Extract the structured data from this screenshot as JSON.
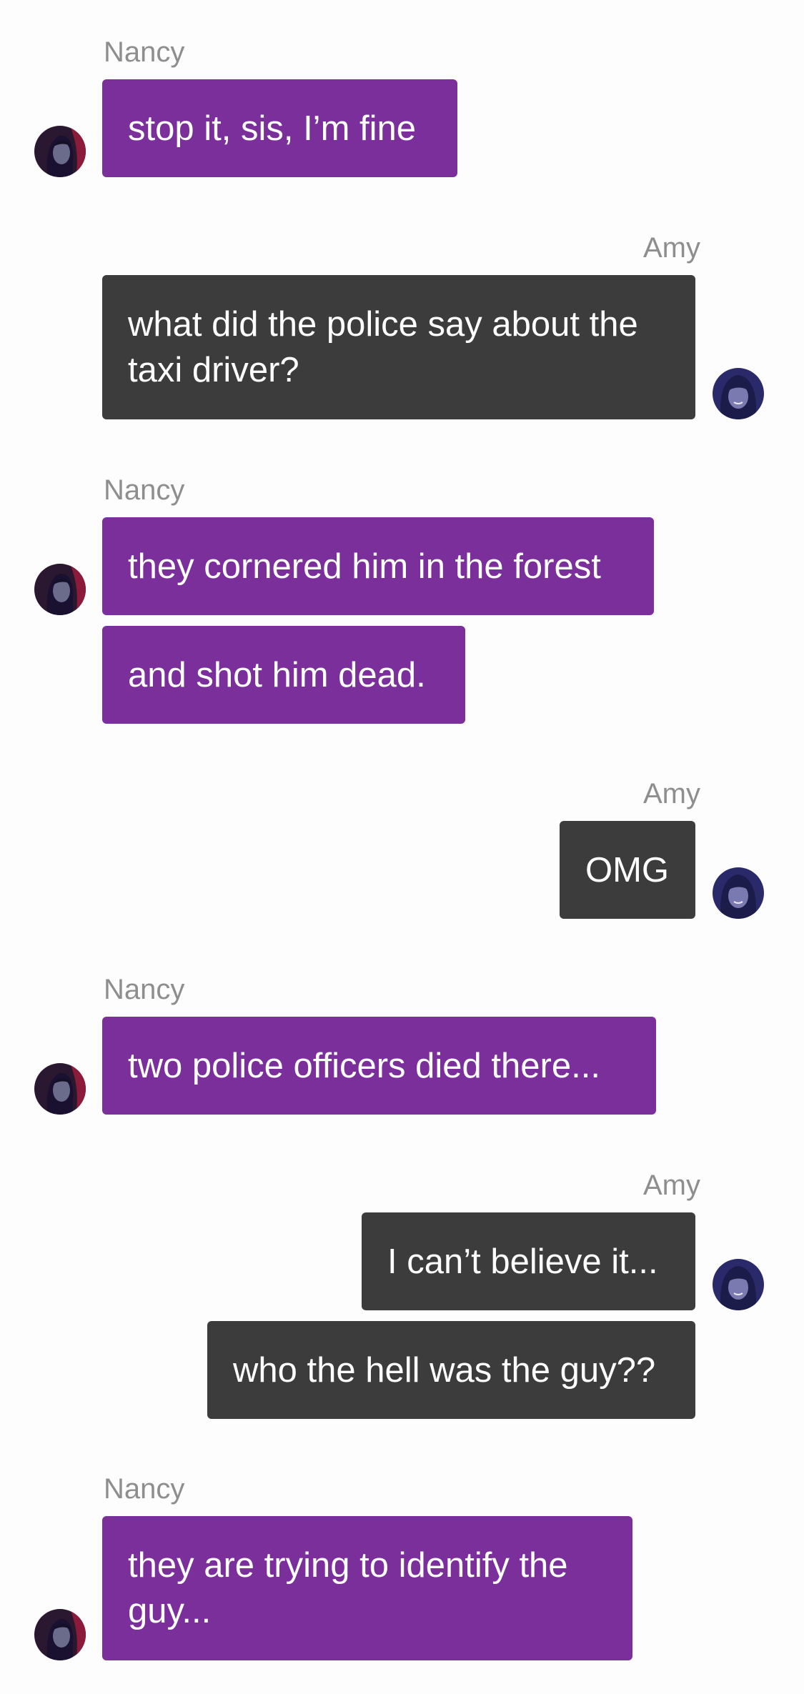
{
  "colors": {
    "background": "#fdfdfd",
    "nancy_bubble": "#7b2f9b",
    "amy_bubble": "#3c3c3c",
    "name_text": "#8e8e8e",
    "bubble_text": "#ffffff"
  },
  "participants": {
    "nancy": {
      "name": "Nancy",
      "avatar_icon": "nancy-avatar-icon"
    },
    "amy": {
      "name": "Amy",
      "avatar_icon": "amy-avatar-icon"
    }
  },
  "messages": [
    {
      "sender": "Nancy",
      "text": "stop it, sis, I’m fine"
    },
    {
      "sender": "Amy",
      "text": "what did the police say about the taxi driver?"
    },
    {
      "sender": "Nancy",
      "text": "they cornered him in the forest"
    },
    {
      "sender": "Nancy",
      "text": "and shot him dead."
    },
    {
      "sender": "Amy",
      "text": "OMG"
    },
    {
      "sender": "Nancy",
      "text": "two police officers died there..."
    },
    {
      "sender": "Amy",
      "text": "I can’t believe it..."
    },
    {
      "sender": "Amy",
      "text": "who the hell was the guy??"
    },
    {
      "sender": "Nancy",
      "text": "they are trying to identify the guy..."
    }
  ]
}
